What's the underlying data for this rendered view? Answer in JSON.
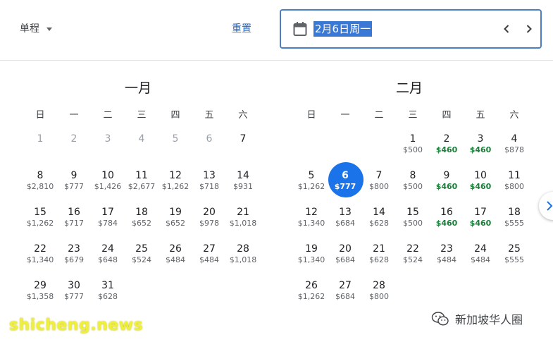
{
  "header": {
    "trip_type": "单程",
    "reset_label": "重置",
    "date_value": "2月6日周一"
  },
  "months": [
    {
      "title": "一月",
      "weekdays": [
        "日",
        "一",
        "二",
        "三",
        "四",
        "五",
        "六"
      ],
      "offset": 0,
      "days": [
        {
          "d": "1",
          "p": "",
          "past": true
        },
        {
          "d": "2",
          "p": "",
          "past": true
        },
        {
          "d": "3",
          "p": "",
          "past": true
        },
        {
          "d": "4",
          "p": "",
          "past": true
        },
        {
          "d": "5",
          "p": "",
          "past": true
        },
        {
          "d": "6",
          "p": "",
          "past": true
        },
        {
          "d": "7",
          "p": ""
        },
        {
          "d": "8",
          "p": "$2,810"
        },
        {
          "d": "9",
          "p": "$777"
        },
        {
          "d": "10",
          "p": "$1,426"
        },
        {
          "d": "11",
          "p": "$2,677"
        },
        {
          "d": "12",
          "p": "$1,262"
        },
        {
          "d": "13",
          "p": "$718"
        },
        {
          "d": "14",
          "p": "$931"
        },
        {
          "d": "15",
          "p": "$1,262"
        },
        {
          "d": "16",
          "p": "$717"
        },
        {
          "d": "17",
          "p": "$784"
        },
        {
          "d": "18",
          "p": "$652"
        },
        {
          "d": "19",
          "p": "$652"
        },
        {
          "d": "20",
          "p": "$978"
        },
        {
          "d": "21",
          "p": "$1,018"
        },
        {
          "d": "22",
          "p": "$1,340"
        },
        {
          "d": "23",
          "p": "$679"
        },
        {
          "d": "24",
          "p": "$648"
        },
        {
          "d": "25",
          "p": "$524"
        },
        {
          "d": "26",
          "p": "$484"
        },
        {
          "d": "27",
          "p": "$484"
        },
        {
          "d": "28",
          "p": "$1,018"
        },
        {
          "d": "29",
          "p": "$1,358"
        },
        {
          "d": "30",
          "p": "$777"
        },
        {
          "d": "31",
          "p": "$628"
        }
      ]
    },
    {
      "title": "二月",
      "weekdays": [
        "日",
        "一",
        "二",
        "三",
        "四",
        "五",
        "六"
      ],
      "offset": 3,
      "days": [
        {
          "d": "1",
          "p": "$500"
        },
        {
          "d": "2",
          "p": "$460",
          "low": true
        },
        {
          "d": "3",
          "p": "$460",
          "low": true
        },
        {
          "d": "4",
          "p": "$878"
        },
        {
          "d": "5",
          "p": "$1,262"
        },
        {
          "d": "6",
          "p": "$777",
          "selected": true
        },
        {
          "d": "7",
          "p": "$800"
        },
        {
          "d": "8",
          "p": "$500"
        },
        {
          "d": "9",
          "p": "$460",
          "low": true
        },
        {
          "d": "10",
          "p": "$460",
          "low": true
        },
        {
          "d": "11",
          "p": "$800"
        },
        {
          "d": "12",
          "p": "$1,340"
        },
        {
          "d": "13",
          "p": "$684"
        },
        {
          "d": "14",
          "p": "$628"
        },
        {
          "d": "15",
          "p": "$500"
        },
        {
          "d": "16",
          "p": "$460",
          "low": true
        },
        {
          "d": "17",
          "p": "$460",
          "low": true
        },
        {
          "d": "18",
          "p": "$555"
        },
        {
          "d": "19",
          "p": "$1,340"
        },
        {
          "d": "20",
          "p": "$684"
        },
        {
          "d": "21",
          "p": "$628"
        },
        {
          "d": "22",
          "p": "$524"
        },
        {
          "d": "23",
          "p": "$484"
        },
        {
          "d": "24",
          "p": "$484"
        },
        {
          "d": "25",
          "p": "$555"
        },
        {
          "d": "26",
          "p": "$1,262"
        },
        {
          "d": "27",
          "p": "$684"
        },
        {
          "d": "28",
          "p": "$800"
        }
      ]
    }
  ],
  "watermarks": {
    "site": "shicheng.news",
    "account": "新加坡华人圈"
  },
  "colors": {
    "accent": "#1a73e8",
    "low_price": "#188038",
    "watermark": "#f0f03a"
  },
  "icons": {
    "calendar": "calendar-icon",
    "prev": "chevron-left-icon",
    "next": "chevron-right-icon",
    "side": "chevron-right-icon",
    "wechat": "wechat-icon"
  }
}
